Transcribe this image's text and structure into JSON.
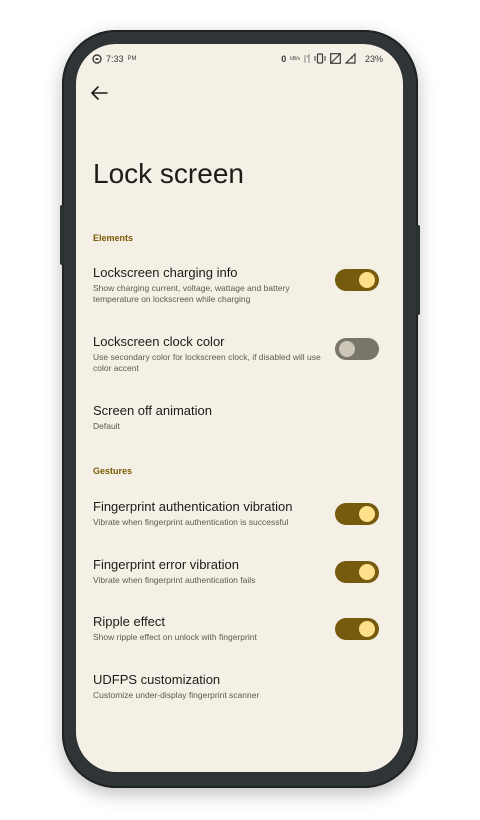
{
  "status_bar": {
    "time": "7:33",
    "ampm": "PM",
    "net_speed": "0",
    "net_unit": "kB/s",
    "battery": "23%"
  },
  "page": {
    "title": "Lock screen"
  },
  "sections": [
    {
      "label": "Elements"
    },
    {
      "label": "Gestures"
    }
  ],
  "items": [
    {
      "title": "Lockscreen charging info",
      "subtitle": "Show charging current, voltage, wattage and battery temperature on lockscreen while charging",
      "toggle": true
    },
    {
      "title": "Lockscreen clock color",
      "subtitle": "Use secondary color for lockscreen clock, if disabled will use color accent",
      "toggle": false
    },
    {
      "title": "Screen off animation",
      "subtitle": "Default"
    },
    {
      "title": "Fingerprint authentication vibration",
      "subtitle": "Vibrate when fingerprint authentication is successful",
      "toggle": true
    },
    {
      "title": "Fingerprint error vibration",
      "subtitle": "Vibrate when fingerprint authentication fails",
      "toggle": true
    },
    {
      "title": "Ripple effect",
      "subtitle": "Show ripple effect on unlock with fingerprint",
      "toggle": true
    },
    {
      "title": "UDFPS customization",
      "subtitle": "Customize under-display fingerprint scanner"
    }
  ],
  "colors": {
    "accent": "#765a0d",
    "toggle_knob_on": "#ffe08a",
    "background": "#f5f0e5"
  },
  "icons": [
    "back-arrow-icon",
    "app-notification-icon",
    "vibrate-icon",
    "signal-icon",
    "battery-icon"
  ]
}
